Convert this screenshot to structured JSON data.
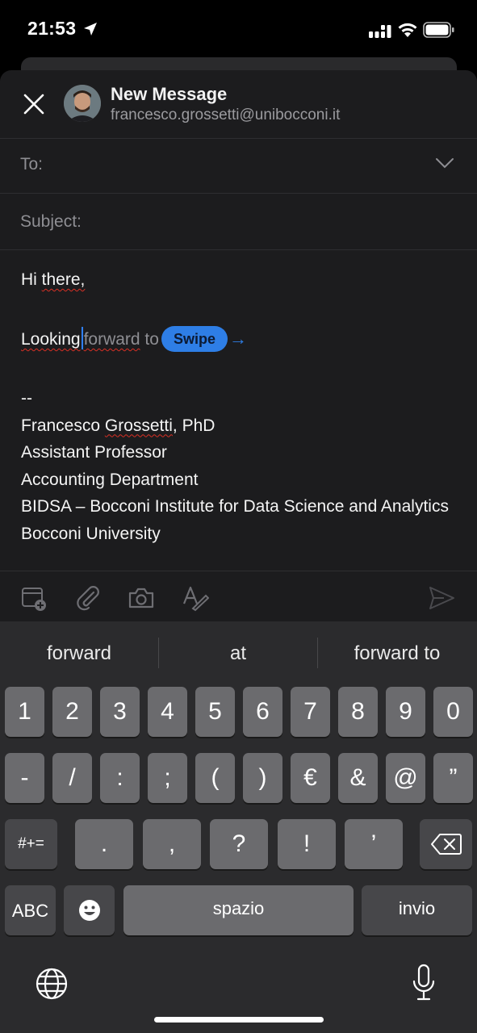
{
  "status_bar": {
    "time": "21:53"
  },
  "compose": {
    "title": "New Message",
    "from_email": "francesco.grossetti@unibocconi.it",
    "to_label": "To:",
    "subject_label": "Subject:"
  },
  "body": {
    "greeting": "Hi there,",
    "typed_word": "Looking",
    "ghost_word1": "forward",
    "ghost_word2": " to",
    "swipe_label": "Swipe",
    "swipe_arrow": "→",
    "sig_dashes": "--",
    "sig_name_first": "Francesco ",
    "sig_name_last": "Grossetti",
    "sig_name_suffix": ", PhD",
    "sig_title": "Assistant Professor",
    "sig_dept": "Accounting Department",
    "sig_inst": "BIDSA – Bocconi Institute for Data Science and Analytics",
    "sig_univ": "Bocconi University"
  },
  "toolbar": {
    "icons": [
      "calendar-add-icon",
      "attachment-icon",
      "camera-icon",
      "format-text-icon",
      "send-icon"
    ]
  },
  "keyboard": {
    "suggestions": [
      "forward",
      "at",
      "forward to"
    ],
    "row1": [
      "1",
      "2",
      "3",
      "4",
      "5",
      "6",
      "7",
      "8",
      "9",
      "0"
    ],
    "row2": [
      "-",
      "/",
      ":",
      ";",
      "(",
      ")",
      "€",
      "&",
      "@",
      "”"
    ],
    "row3_shift": "#+=",
    "row3": [
      ".",
      ",",
      "?",
      "!",
      "’"
    ],
    "abc_label": "ABC",
    "space_label": "spazio",
    "return_label": "invio"
  },
  "colors": {
    "accent": "#2e7ee6",
    "sheet_bg": "#1c1c1e",
    "key_bg": "#6b6b6e"
  }
}
